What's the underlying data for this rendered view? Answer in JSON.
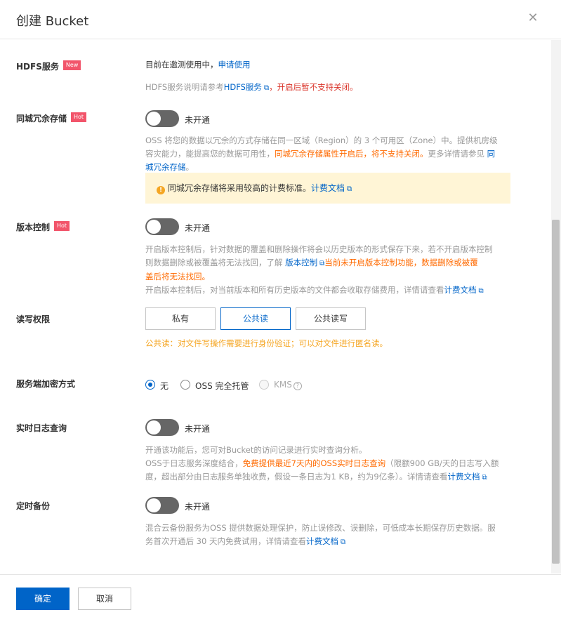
{
  "header": {
    "title": "创建 Bucket",
    "close_icon": "close-icon"
  },
  "hdfs": {
    "label": "HDFS服务",
    "tag": "New",
    "line1_prefix": "目前在邀测使用中，",
    "line1_link": "申请使用",
    "line2_prefix": "HDFS服务说明请参考",
    "line2_link": "HDFS服务",
    "line2_suffix": "，开启后暂不支持关闭。"
  },
  "redundancy": {
    "label": "同城冗余存储",
    "tag": "Hot",
    "switch_label": "未开通",
    "desc_line1": "OSS 将您的数据以冗余的方式存储在同一区域（Region）的 3 个可用区（Zone）中。提供机房级",
    "desc_line2_prefix": "容灾能力，能提高您的数据可用性，",
    "desc_line2_orange": "同城冗余存储属性开启后，将不支持关闭。",
    "desc_line2_suffix": "更多详情请参见",
    "desc_line2_link": "同",
    "desc_line3_link": "城冗余存储",
    "desc_line3_suffix": "。",
    "warning_text": "同城冗余存储将采用较高的计费标准。",
    "warning_link": "计费文档"
  },
  "versioning": {
    "label": "版本控制",
    "tag": "Hot",
    "switch_label": "未开通",
    "desc_line1": "开启版本控制后，针对数据的覆盖和删除操作将会以历史版本的形式保存下来，若不开启版本控制",
    "desc_line2_prefix": "则数据删除或被覆盖将无法找回，了解",
    "desc_line2_link": "版本控制",
    "desc_line2_orange": "当前未开启版本控制功能，数据删除或被覆",
    "desc_line3_orange": "盖后将无法找回。",
    "desc_line4_prefix": "开启版本控制后，对当前版本和所有历史版本的文件都会收取存储费用，详情请查看",
    "desc_line4_link": "计费文档"
  },
  "acl": {
    "label": "读写权限",
    "options": [
      "私有",
      "公共读",
      "公共读写"
    ],
    "selected": "公共读",
    "hint": "公共读：对文件写操作需要进行身份验证；可以对文件进行匿名读。"
  },
  "encryption": {
    "label": "服务端加密方式",
    "options": [
      {
        "label": "无",
        "checked": true,
        "disabled": false
      },
      {
        "label": "OSS 完全托管",
        "checked": false,
        "disabled": false
      },
      {
        "label": "KMS",
        "checked": false,
        "disabled": true
      }
    ]
  },
  "log": {
    "label": "实时日志查询",
    "switch_label": "未开通",
    "desc_line1": "开通该功能后，您可对Bucket的访问记录进行实时查询分析。",
    "desc_line2_prefix": "OSS于日志服务深度结合，",
    "desc_line2_orange": "免费提供最近7天内的OSS实时日志查询",
    "desc_line2_suffix": "（限额900 GB/天的日志写入额",
    "desc_line3_prefix": "度，超出部分由日志服务单独收费，假设一条日志为1 KB，约为9亿条）。详情请查看",
    "desc_line3_link": "计费文档"
  },
  "backup": {
    "label": "定时备份",
    "switch_label": "未开通",
    "desc_line1": "混合云备份服务为OSS 提供数据处理保护，防止误修改、误删除，可低成本长期保存历史数据。服",
    "desc_line2_prefix": "务首次开通后 30 天内免费试用，详情请查看",
    "desc_line2_link": "计费文档"
  },
  "footer": {
    "confirm": "确定",
    "cancel": "取消"
  },
  "colors": {
    "primary": "#0064c8",
    "tag": "#f2556b",
    "orange": "#ff6a00",
    "red": "#d93026",
    "warning_bg": "#fff5d6"
  }
}
